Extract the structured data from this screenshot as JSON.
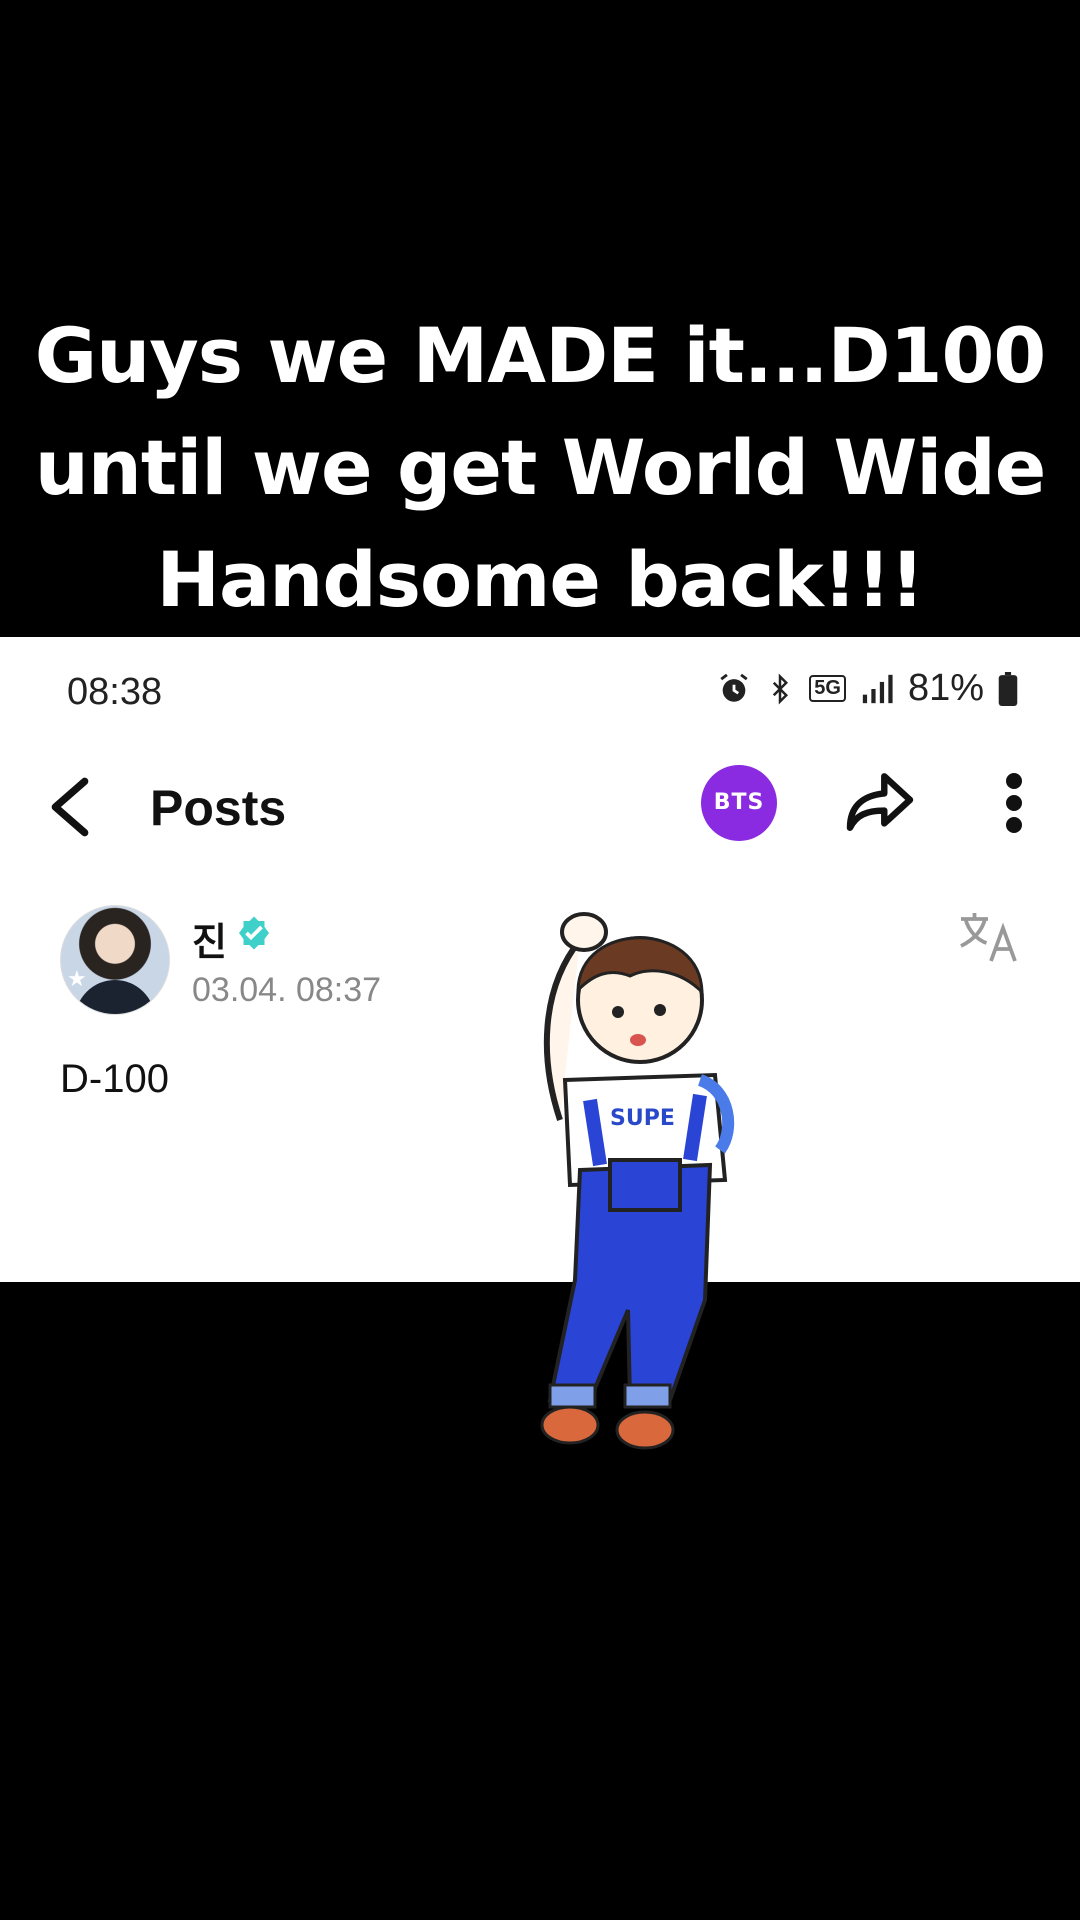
{
  "caption": {
    "line1": "Guys we MADE it...D100",
    "line2": "until we get World Wide",
    "line3": "Handsome back!!!"
  },
  "statusbar": {
    "time": "08:38",
    "network": "5G",
    "battery": "81%",
    "icons": [
      "alarm-icon",
      "bluetooth-icon",
      "5g-icon",
      "signal-icon",
      "battery-icon"
    ]
  },
  "appbar": {
    "title": "Posts",
    "community_badge": "BTS",
    "icons": [
      "back-arrow-icon",
      "share-icon",
      "more-vertical-icon"
    ]
  },
  "post": {
    "author": "진",
    "timestamp": "03.04. 08:37",
    "body": "D-100",
    "icons": [
      "verified-icon",
      "translate-icon"
    ]
  },
  "colors": {
    "badge": "#8a2be2",
    "verified": "#3fd0c9"
  }
}
